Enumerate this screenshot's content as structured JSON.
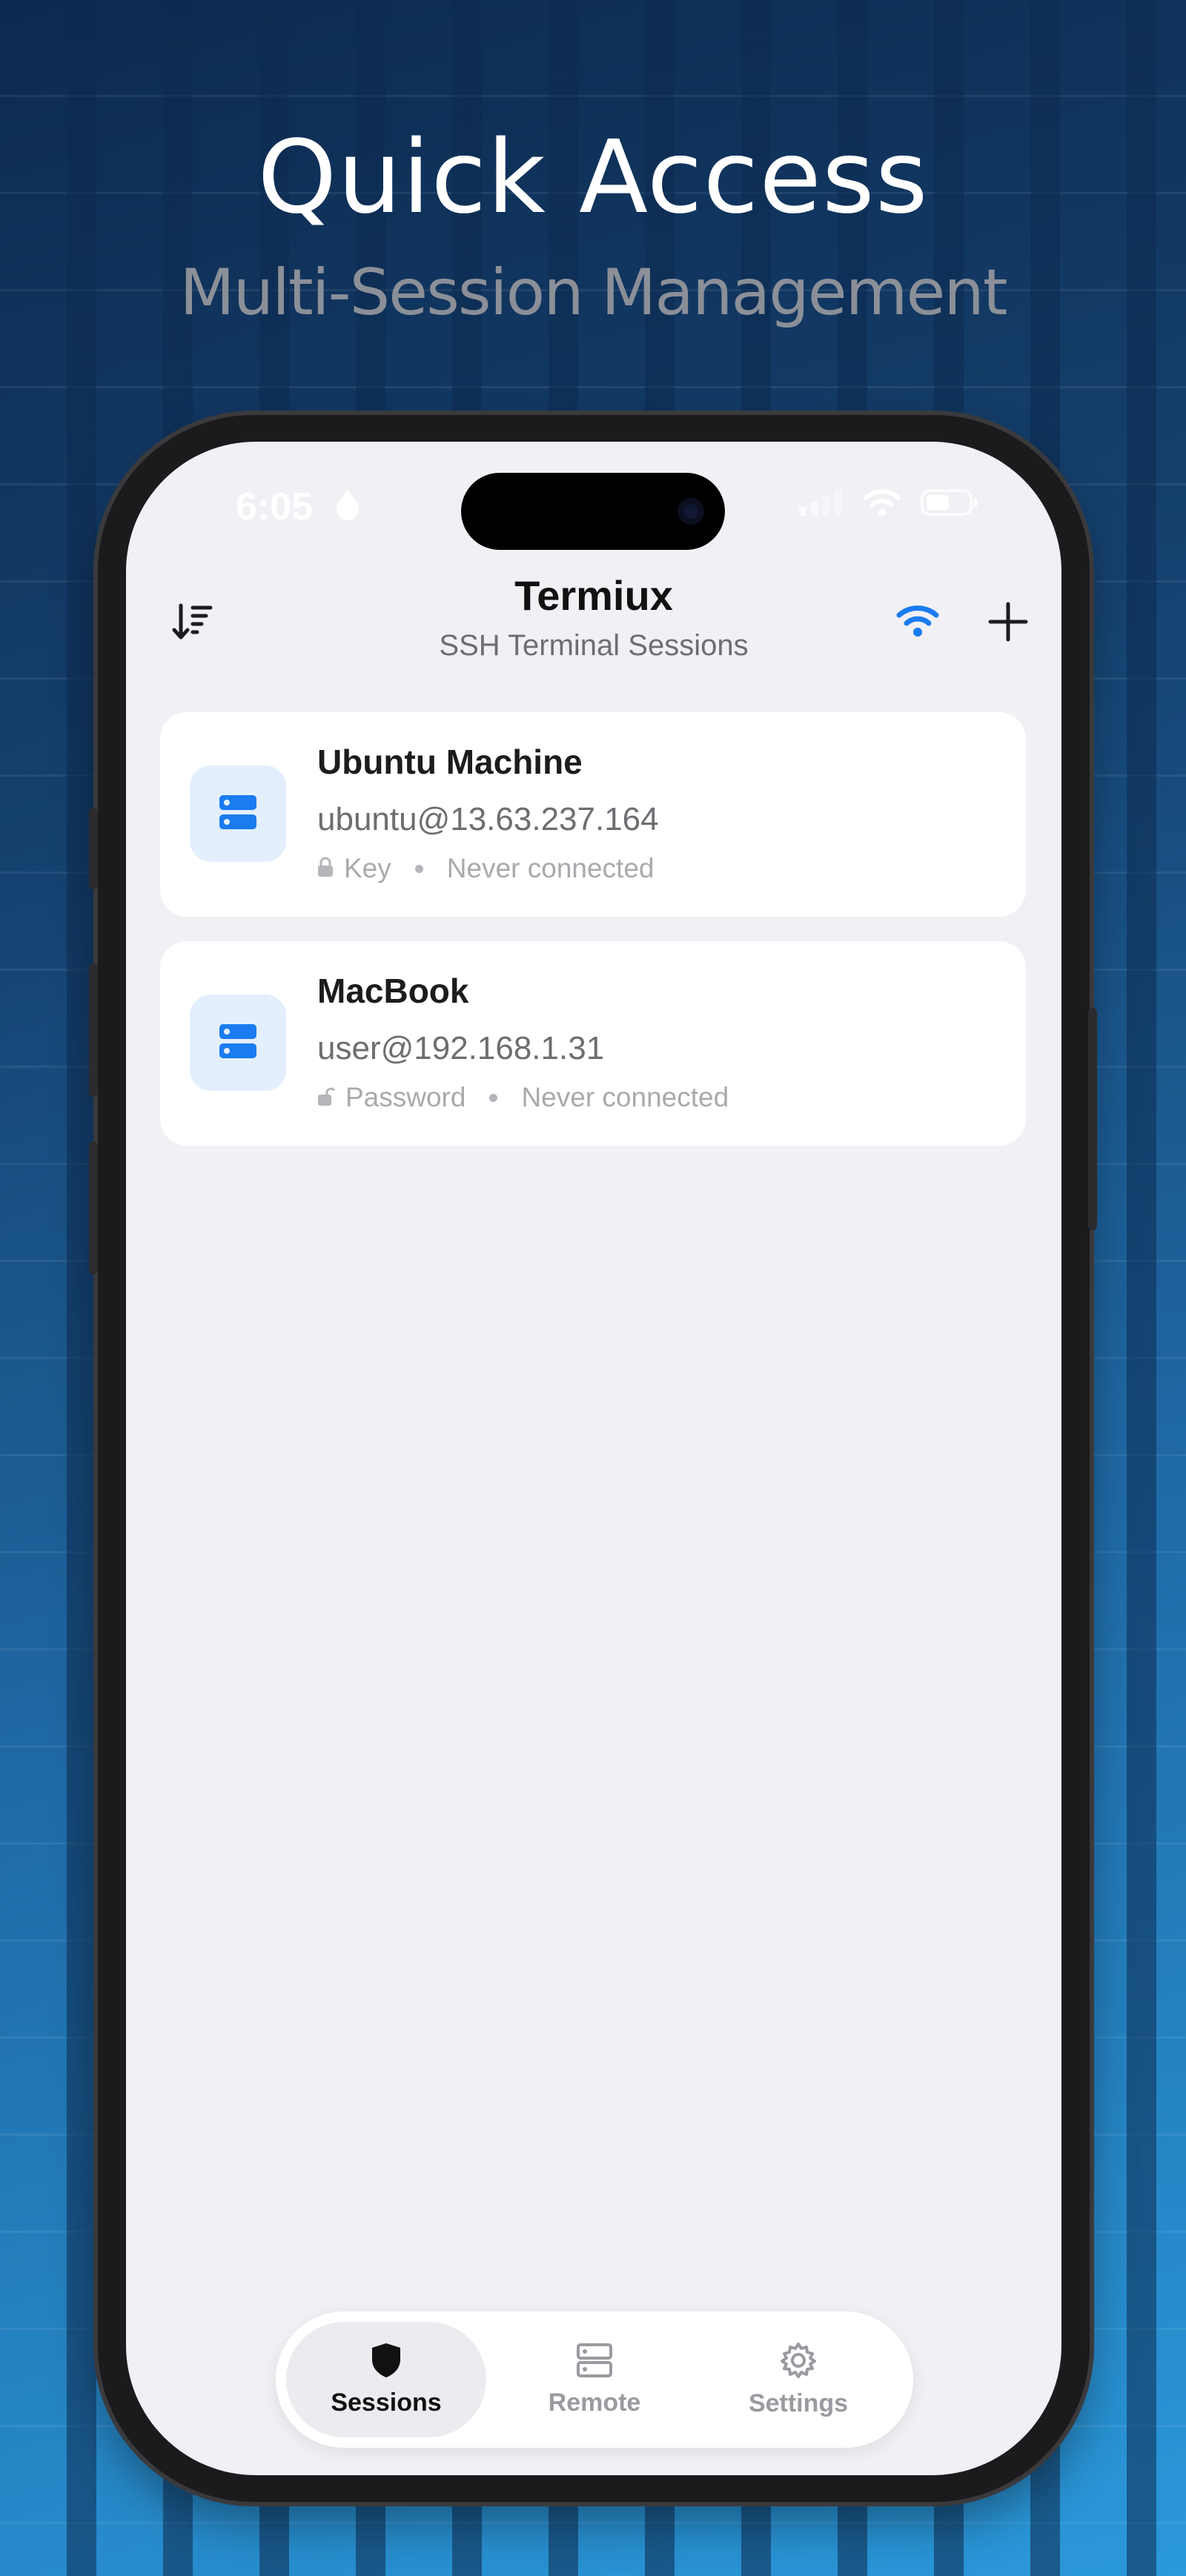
{
  "hero": {
    "title": "Quick Access",
    "subtitle": "Multi-Session Management"
  },
  "status_bar": {
    "time": "6:05"
  },
  "header": {
    "title": "Termiux",
    "subtitle": "SSH Terminal Sessions",
    "icons": [
      "sort-icon",
      "wifi-icon",
      "plus-icon"
    ]
  },
  "sessions": [
    {
      "name": "Ubuntu Machine",
      "host": "ubuntu@13.63.237.164",
      "auth": "Key",
      "status": "Never connected",
      "auth_icon": "lock-icon"
    },
    {
      "name": "MacBook",
      "host": "user@192.168.1.31",
      "auth": "Password",
      "status": "Never connected",
      "auth_icon": "unlock-icon"
    }
  ],
  "tabbar": {
    "tabs": [
      {
        "label": "Sessions",
        "icon": "shield-icon",
        "active": true
      },
      {
        "label": "Remote",
        "icon": "server-icon",
        "active": false
      },
      {
        "label": "Settings",
        "icon": "gear-icon",
        "active": false
      }
    ]
  },
  "colors": {
    "accent": "#1a7cf0",
    "card_icon_bg": "#e3effd",
    "screen_bg": "#f1f0f5",
    "tab_active": "#111111",
    "tab_inactive": "#9a9aa0"
  }
}
